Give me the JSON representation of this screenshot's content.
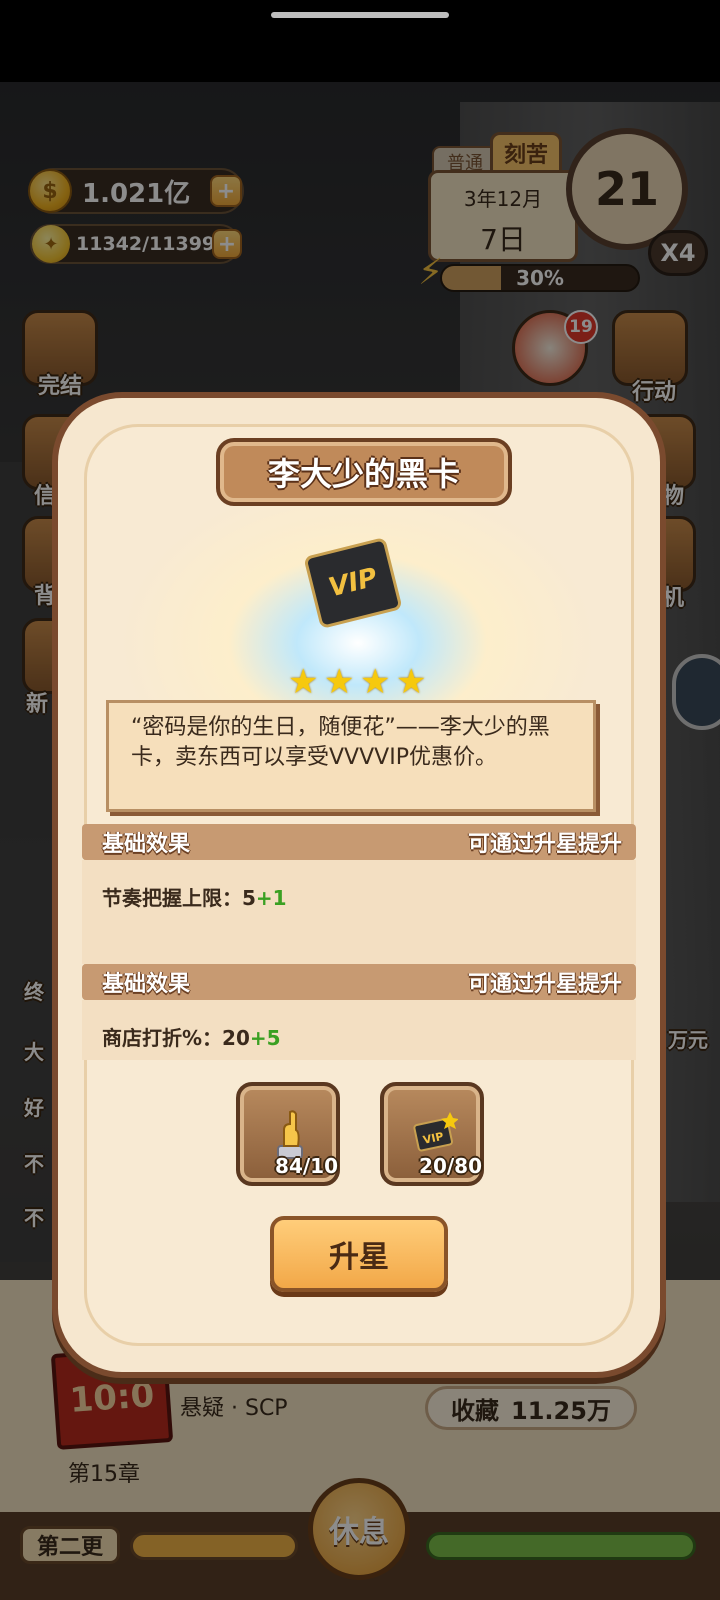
{
  "header": {
    "coins": "1.021亿",
    "ideas": "11342/11399",
    "mode_normal": "普通",
    "mode_hard": "刻苦",
    "date_year_month": "3年12月",
    "date_day": "7日",
    "day_count": "21",
    "speed": "X4",
    "energy_percent": "30%",
    "energy_fraction": 0.3
  },
  "side_left": {
    "finish_label": "完结",
    "item_2": "信",
    "item_3": "背",
    "item_4": "新"
  },
  "side_right": {
    "badge_count": "19",
    "action_label": "行动",
    "item_2": "物",
    "item_3": "机"
  },
  "background_peek": {
    "row1": "终",
    "row2": "大",
    "row3": "好",
    "row4": "不",
    "row5": "不",
    "money_suffix": "万元"
  },
  "modal": {
    "title": "李大少的黑卡",
    "vip_text": "VIP",
    "star_count": 4,
    "description": "“密码是你的生日，随便花”——李大少的黑卡，卖东西可以享受VVVVIP优惠价。",
    "effects": [
      {
        "header": "基础效果",
        "hint": "可通过升星提升",
        "label": "节奏把握上限：",
        "base": "5",
        "bonus": "+1"
      },
      {
        "header": "基础效果",
        "hint": "可通过升星提升",
        "label": "商店打折%：",
        "base": "20",
        "bonus": "+5"
      }
    ],
    "materials": [
      {
        "icon": "hand-statue-icon",
        "count": "84/10"
      },
      {
        "icon": "vip-card-icon",
        "count": "20/80"
      }
    ],
    "upgrade_label": "升星"
  },
  "bottom": {
    "book_cover_text": "10:0",
    "genre": "悬疑 · SCP",
    "chapter": "第15章",
    "collect_label": "收藏",
    "collect_value": "11.25万",
    "update_tab": "第二更",
    "rest_label": "休息"
  }
}
